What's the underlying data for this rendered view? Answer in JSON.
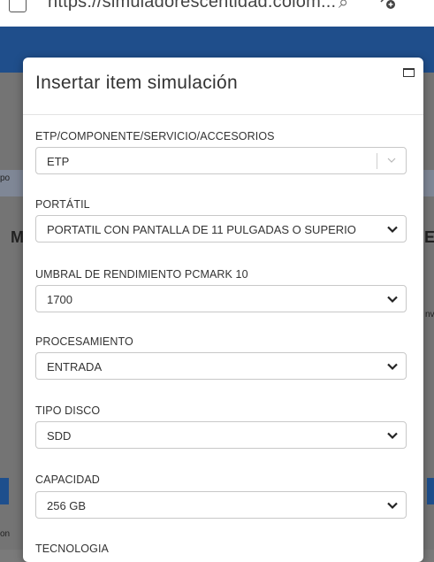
{
  "browser": {
    "url": "https://simuladorescentidad.colom...",
    "search_icon": "search-icon",
    "add_favorite_icon": "add-favorite-icon"
  },
  "colors": {
    "appbar": "#1f4e8b",
    "overlay": "#747474",
    "modal": "#ffffff",
    "border": "#c8c8c8",
    "text": "#333333"
  },
  "background": {
    "frag_left_small": "ро",
    "frag_left_letter": "M",
    "frag_right_letter": "E",
    "frag_right_small": "nv",
    "frag_bottom_left": "on"
  },
  "modal": {
    "title": "Insertar item simulación",
    "fields": [
      {
        "label": "ETP/COMPONENTE/SERVICIO/ACCESORIOS",
        "value": "ETP"
      },
      {
        "label": "PORTÁTIL",
        "value": "PORTATIL CON PANTALLA DE 11 PULGADAS O SUPERIO"
      },
      {
        "label": "UMBRAL DE RENDIMIENTO PCMARK 10",
        "value": "1700"
      },
      {
        "label": "PROCESAMIENTO",
        "value": "ENTRADA"
      },
      {
        "label": "TIPO DISCO",
        "value": "SDD"
      },
      {
        "label": "CAPACIDAD",
        "value": "256 GB"
      },
      {
        "label": "TECNOLOGIA",
        "value": ""
      }
    ]
  }
}
